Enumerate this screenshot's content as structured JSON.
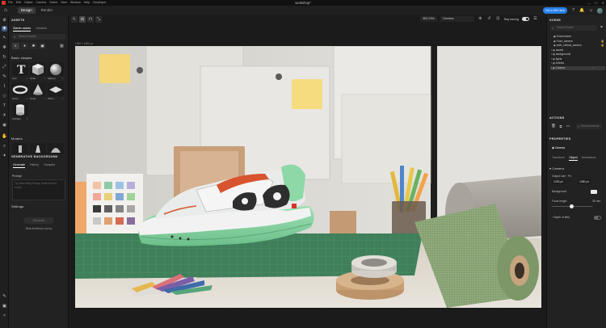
{
  "menubar": {
    "items": [
      "File",
      "Edit",
      "Object",
      "Camera",
      "Select",
      "View",
      "Window",
      "Help",
      "Developer"
    ],
    "title": "workshop*",
    "win_min": "—",
    "win_max": "☐",
    "win_close": "✕"
  },
  "header": {
    "tabs": [
      "Design",
      "Render"
    ],
    "cta_label": "Get a Gift Here",
    "icons": {
      "home": "⌂",
      "help": "?",
      "bell": "🔔",
      "account": "☺"
    }
  },
  "left_panel": {
    "assets_title": "ASSETS",
    "sub_tabs": [
      "Starter assets",
      "Libraries"
    ],
    "search_placeholder": "Search Assets",
    "basic_shapes_title": "Basic shapes",
    "shapes": [
      {
        "label": "Text",
        "fav": "☆"
      },
      {
        "label": "Cube",
        "fav": "☆"
      },
      {
        "label": "Sphere",
        "fav": "☆"
      },
      {
        "label": "Torus",
        "fav": "☆"
      },
      {
        "label": "Cone",
        "fav": "☆"
      },
      {
        "label": "Plane",
        "fav": "☆"
      },
      {
        "label": "Cylinder",
        "fav": "☆"
      }
    ],
    "models_title": "Models",
    "gen_bg_title": "GENERATIVE BACKGROUND",
    "gen_tabs": [
      "Generate",
      "History",
      "Samples"
    ],
    "prompt_label": "Prompt",
    "prompt_placeholder": "Try describing things, environment, mood",
    "settings_title": "Settings",
    "generate_button": "Generate",
    "beta_survey": "Beta feedback survey"
  },
  "toolbar": {
    "zoom": "353.23%",
    "camera_dropdown": "Camera",
    "ray_tracing_label": "Ray tracing",
    "resolution_label": "1920 × 1080 px"
  },
  "right_panel": {
    "scene_title": "SCENE",
    "search_placeholder": "Search Scene",
    "tree": [
      {
        "label": "Environment",
        "depth": 1
      },
      {
        "label": "Front_camera",
        "depth": 1
      },
      {
        "label": "wide_vertical_camera",
        "depth": 1
      },
      {
        "label": "assets",
        "depth": 1
      },
      {
        "label": "backgrounds",
        "depth": 1
      },
      {
        "label": "lights",
        "depth": 1
      },
      {
        "label": "Articles",
        "depth": 1
      },
      {
        "label": "Camera",
        "depth": 1
      }
    ],
    "actions_title": "ACTIONS",
    "actions_search_placeholder": "Search actions",
    "properties_title": "PROPERTIES",
    "object_name": "Camera",
    "prop_tabs": [
      "Transform",
      "Object",
      "Animations"
    ],
    "camera_section": "Camera",
    "output_size_label": "Output size",
    "output_size_value": "Px",
    "width_value": "1250 px",
    "height_value": "1080 px",
    "background_label": "Background",
    "focal_length_label": "Focal length",
    "focal_length_value": "35 mm",
    "depth_of_field_label": "Depth of field"
  },
  "colors": {
    "accent": "#2680eb",
    "active_rail": "#3b5a88",
    "cutting_mat": "#3f7f5a",
    "shoe_green": "#8ed8a8",
    "sticky_note": "#f4d77a"
  }
}
